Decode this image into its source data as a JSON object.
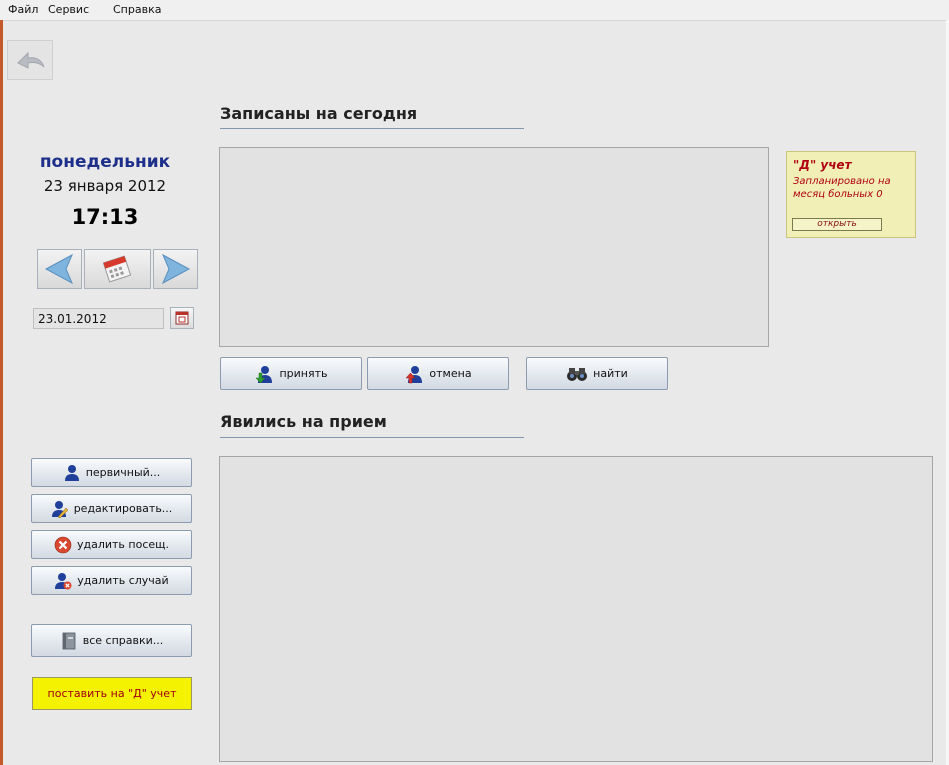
{
  "menu": [
    "Файл",
    "Сервис",
    "Справка"
  ],
  "icons": {
    "back": "back-arrow-icon",
    "prev": "left-arrow-icon",
    "calendar": "calendar-icon",
    "next": "right-arrow-icon",
    "accept": "user-green-arrow-icon",
    "cancel": "user-red-arrow-icon",
    "find": "binoculars-icon",
    "primary": "user-icon",
    "edit": "user-edit-icon",
    "delete_visit": "delete-circle-icon",
    "delete_case": "user-delete-icon",
    "references": "book-icon"
  },
  "date_panel": {
    "day_of_week": "понедельник",
    "date": "23 января 2012",
    "time": "17:13",
    "date_field": "23.01.2012"
  },
  "scheduled": {
    "title": "Записаны на сегодня",
    "accept_label": "принять",
    "cancel_label": "отмена",
    "find_label": "найти"
  },
  "arrived": {
    "title": "Явились на прием"
  },
  "actions": {
    "primary_label": "первичный...",
    "edit_label": "редактировать...",
    "delete_visit_label": "удалить посещ.",
    "delete_case_label": "удалить случай",
    "references_label": "все справки...",
    "register_d_label": "поставить на \"Д\" учет"
  },
  "d_account": {
    "title": "\"Д\" учет",
    "text": "Запланировано на месяц больных 0",
    "open_label": "открыть"
  },
  "colors": {
    "background": "#e9e9e9",
    "day_of_week": "#1e2f8a",
    "d_panel_bg": "#f1efb6",
    "d_text": "#b00010",
    "register_bg": "#f5f200"
  }
}
